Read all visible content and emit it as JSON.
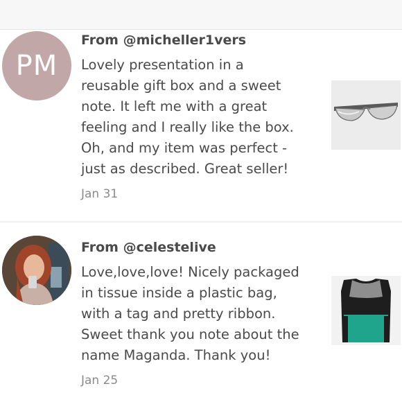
{
  "reviews": [
    {
      "from": "From @micheller1vers",
      "avatar_initials": "PM",
      "text": "Lovely presentation in a\nreusable gift box and a sweet\nnote. It left me with a great\nfeeling and I really like the box.\nOh, and my item was perfect -\njust as described. Great seller!",
      "date": "Jan 31",
      "thumbnail_icon": "sunglasses-icon"
    },
    {
      "from": "From @celestelive",
      "avatar_icon": "user-photo-icon",
      "text": "Love,love,love! Nicely packaged\nin tissue inside a plastic bag,\nwith a tag and pretty ribbon.\nSweet thank you note about the\nname Maganda. Thank you!",
      "date": "Jan 25",
      "thumbnail_icon": "top-garment-icon"
    }
  ],
  "colors": {
    "avatar_pm": "#c1a7a7",
    "garment_teal": "#1fa58c",
    "garment_black": "#1e1e1e"
  }
}
